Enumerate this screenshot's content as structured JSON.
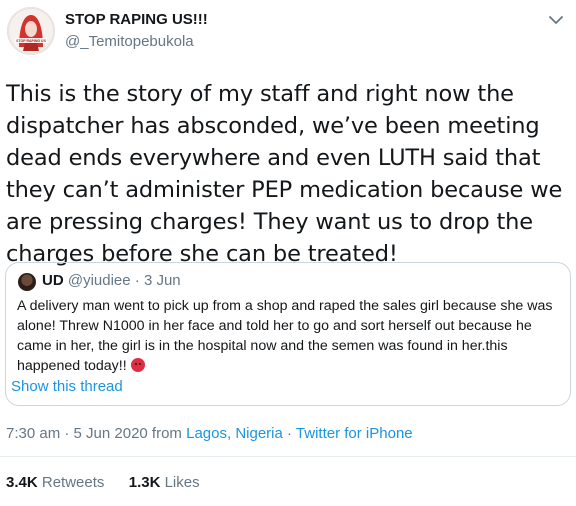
{
  "author": {
    "display_name": "STOP RAPING US!!!",
    "handle": "@_Temitopebukola",
    "avatar_icon": "profile-photo-avatar",
    "avatar_caption": "STOP RAPING US"
  },
  "tweet": {
    "text": "This is the story of my staff and right now the dispatcher has absconded, we’ve been meeting dead ends everywhere and even LUTH said that they can’t administer PEP medication because we are pressing charges! They want us to drop the charges before she can be treated!"
  },
  "quoted": {
    "display_name": "UD",
    "handle": "@yiudiee",
    "separator": "·",
    "date": "3 Jun",
    "text": "A delivery man went to pick up from a shop and raped the sales girl because she was alone! Threw N1000 in her face and told her to go and sort herself out because he came in her, the girl is in the hospital now and the semen was found in her.this happened today!!",
    "emoji": "angry-face-emoji",
    "show_thread": "Show this thread"
  },
  "meta": {
    "time_date": "7:30 am · 5 Jun 2020 from ",
    "location": "Lagos, Nigeria",
    "separator": " · ",
    "source": "Twitter for iPhone"
  },
  "stats": {
    "retweets_count": "3.4K",
    "retweets_label": "Retweets",
    "likes_count": "1.3K",
    "likes_label": "Likes"
  },
  "colors": {
    "link": "#1b95e0",
    "secondary_text": "#657786",
    "border": "#ccd6dd",
    "avatar_red": "#d0342c"
  }
}
